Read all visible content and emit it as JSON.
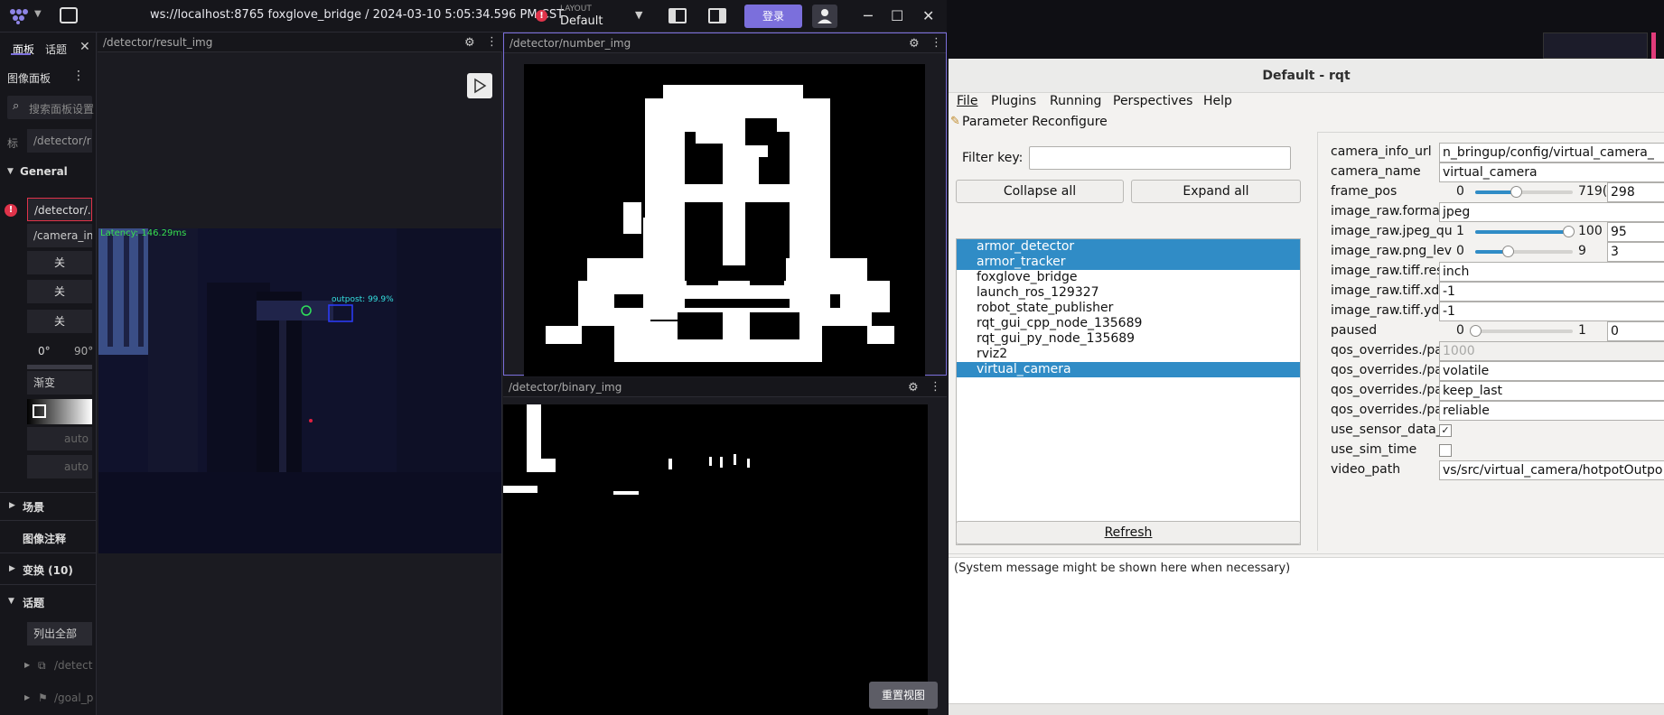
{
  "topbar": {
    "connection": "ws://localhost:8765 foxglove_bridge / 2024-03-10 5:05:34.596 PM CST",
    "layout_label": "LAYOUT",
    "layout_value": "Default",
    "login_label": "登录"
  },
  "sidebar": {
    "tabs": [
      "面板",
      "话题"
    ],
    "panel_title": "图像面板",
    "search_placeholder": "搜索面板设置",
    "topic_label": "标",
    "topic_value": "/detector/r",
    "general": "General",
    "image_topic": "/detector/..",
    "camera_info": "/camera_in",
    "off1": "关",
    "off2": "关",
    "off3": "关",
    "rot0": "0°",
    "rot90": "90°",
    "gradient": "渐变",
    "auto1": "auto",
    "auto2": "auto",
    "scene": "场景",
    "annotations": "图像注释",
    "transforms": "变换 (10)",
    "topics": "话题",
    "list_all": "列出全部",
    "topic_item1": "/detect",
    "topic_item2": "/goal_p"
  },
  "panels": {
    "result": {
      "title": "/detector/result_img",
      "latency": "Latency: 146.29ms",
      "detection": "outpost: 99.9%"
    },
    "number": {
      "title": "/detector/number_img"
    },
    "binary": {
      "title": "/detector/binary_img",
      "reset_label": "重置视图"
    }
  },
  "rqt": {
    "title": "Default - rqt",
    "menus": [
      "File",
      "Plugins",
      "Running",
      "Perspectives",
      "Help"
    ],
    "plugin_title": "Parameter Reconfigure",
    "filter_label": "Filter key:",
    "collapse": "Collapse all",
    "expand": "Expand all",
    "refresh": "Refresh",
    "nodes": [
      {
        "name": "armor_detector",
        "selected": true
      },
      {
        "name": "armor_tracker",
        "selected": true
      },
      {
        "name": "foxglove_bridge",
        "selected": false
      },
      {
        "name": "launch_ros_129327",
        "selected": false
      },
      {
        "name": "robot_state_publisher",
        "selected": false
      },
      {
        "name": "rqt_gui_cpp_node_135689",
        "selected": false
      },
      {
        "name": "rqt_gui_py_node_135689",
        "selected": false
      },
      {
        "name": "rviz2",
        "selected": false
      },
      {
        "name": "virtual_camera",
        "selected": true
      }
    ],
    "params": {
      "camera_info_url": {
        "name": "camera_info_url",
        "value": "n_bringup/config/virtual_camera_"
      },
      "camera_name": {
        "name": "camera_name",
        "value": "virtual_camera"
      },
      "frame_pos": {
        "name": "frame_pos",
        "min": "0",
        "max": "719(",
        "value": "298",
        "fraction": 0.42
      },
      "image_format": {
        "name": "image_raw.format",
        "value": "jpeg"
      },
      "jpeg_quality": {
        "name": "image_raw.jpeg_qu",
        "min": "1",
        "max": "100",
        "value": "95",
        "fraction": 0.95
      },
      "png_level": {
        "name": "image_raw.png_lev",
        "min": "0",
        "max": "9",
        "value": "3",
        "fraction": 0.33
      },
      "tiff_res": {
        "name": "image_raw.tiff.res_",
        "value": "inch"
      },
      "tiff_xdpi": {
        "name": "image_raw.tiff.xdpi",
        "value": "-1"
      },
      "tiff_ydpi": {
        "name": "image_raw.tiff.ydpi",
        "value": "-1"
      },
      "paused": {
        "name": "paused",
        "min": "0",
        "max": "1",
        "value": "0",
        "fraction": 0.0
      },
      "qos1": {
        "name": "qos_overrides./para",
        "value": "1000"
      },
      "qos2": {
        "name": "qos_overrides./para",
        "value": "volatile"
      },
      "qos3": {
        "name": "qos_overrides./para",
        "value": "keep_last"
      },
      "qos4": {
        "name": "qos_overrides./para",
        "value": "reliable"
      },
      "use_sensor": {
        "name": "use_sensor_data_q",
        "checked": "✓"
      },
      "use_sim_time": {
        "name": "use_sim_time",
        "checked": ""
      },
      "video_path": {
        "name": "video_path",
        "value": "vs/src/virtual_camera/hotpotOutpo"
      }
    },
    "status": "(System message might be shown here when necessary)"
  }
}
